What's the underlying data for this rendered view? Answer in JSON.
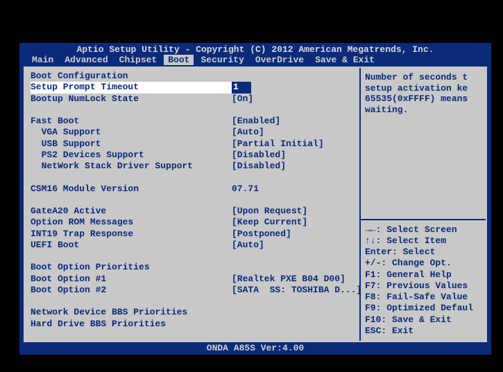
{
  "header": {
    "title": "Aptio Setup Utility - Copyright (C) 2012 American Megatrends, Inc.",
    "tabs": [
      "Main",
      "Advanced",
      "Chipset",
      "Boot",
      "Security",
      "OverDrive",
      "Save & Exit"
    ],
    "active_tab_index": 3
  },
  "main": {
    "section_boot_config": "Boot Configuration",
    "setup_prompt_timeout": {
      "label": "Setup Prompt Timeout",
      "value": "1"
    },
    "bootup_numlock": {
      "label": "Bootup NumLock State",
      "value": "[On]"
    },
    "fast_boot": {
      "label": "Fast Boot",
      "value": "[Enabled]"
    },
    "vga_support": {
      "label": "  VGA Support",
      "value": "[Auto]"
    },
    "usb_support": {
      "label": "  USB Support",
      "value": "[Partial Initial]"
    },
    "ps2_support": {
      "label": "  PS2 Devices Support",
      "value": "[Disabled]"
    },
    "netstack_support": {
      "label": "  NetWork Stack Driver Support",
      "value": "[Disabled]"
    },
    "csm16": {
      "label": "CSM16 Module Version",
      "value": "07.71"
    },
    "gatea20": {
      "label": "GateA20 Active",
      "value": "[Upon Request]"
    },
    "option_rom": {
      "label": "Option ROM Messages",
      "value": "[Keep Current]"
    },
    "int19": {
      "label": "INT19 Trap Response",
      "value": "[Postponed]"
    },
    "uefi_boot": {
      "label": "UEFI Boot",
      "value": "[Auto]"
    },
    "section_priorities": "Boot Option Priorities",
    "boot1": {
      "label": "Boot Option #1",
      "value": "[Realtek PXE B04 D00]"
    },
    "boot2": {
      "label": "Boot Option #2",
      "value": "[SATA  SS: TOSHIBA D...]"
    },
    "net_bbs": {
      "label": "Network Device BBS Priorities"
    },
    "hdd_bbs": {
      "label": "Hard Drive BBS Priorities"
    }
  },
  "help": {
    "desc_line1": "Number of seconds t",
    "desc_line2": "setup activation ke",
    "desc_line3": "65535(0xFFFF) means",
    "desc_line4": "waiting.",
    "k1": "→←: Select Screen",
    "k2": "↑↓: Select Item",
    "k3": "Enter: Select",
    "k4": "+/-: Change Opt.",
    "k5": "F1: General Help",
    "k6": "F7: Previous Values",
    "k7": "F8: Fail-Safe Value",
    "k8": "F9: Optimized Defaul",
    "k9": "F10: Save & Exit",
    "k10": "ESC: Exit"
  },
  "footer": {
    "text": "ONDA A85S Ver:4.00"
  }
}
